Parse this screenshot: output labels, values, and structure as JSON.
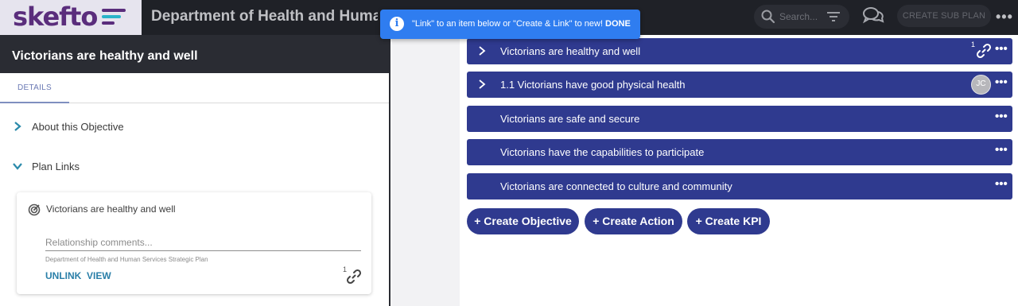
{
  "app": {
    "logo_text": "skefto",
    "brand_colors": {
      "logo": "#5a2d7c",
      "accent": "#2f3a8f",
      "toast": "#2f7df0",
      "link": "#2a7fa8"
    },
    "title": "Department of Health and Human Services Strategic Plan"
  },
  "topbar": {
    "search_placeholder": "Search...",
    "search_icon": "search-icon",
    "filter_icon": "filter-icon",
    "chat_icon": "chat-icon",
    "create_sub_plan_label": "CREATE SUB PLAN",
    "more_icon": "more-icon",
    "more_glyph": "•••"
  },
  "toast": {
    "icon": "info-icon",
    "icon_glyph": "i",
    "message": "\"Link\" to an item below or \"Create & Link\" to new!",
    "done_label": "DONE"
  },
  "left_panel": {
    "title": "Victorians are healthy and well",
    "tabs": [
      {
        "label": "DETAILS",
        "active": true
      }
    ],
    "sections": [
      {
        "label": "About this Objective",
        "expanded": false
      },
      {
        "label": "Plan Links",
        "expanded": true
      }
    ],
    "link_card": {
      "title": "Victorians are healthy and well",
      "icon": "objective-target-icon",
      "comment_placeholder": "Relationship comments...",
      "comment_value": "",
      "plan_name": "Department of Health and Human Services Strategic Plan",
      "unlink_label": "UNLINK",
      "view_label": "VIEW",
      "link_count": "1"
    }
  },
  "list": {
    "items": [
      {
        "label": "Victorians are healthy and well",
        "expandable": true,
        "link_count": "1",
        "has_link": true,
        "avatar": "",
        "more": "•••"
      },
      {
        "label": "1.1 Victorians have good physical health",
        "expandable": true,
        "link_count": "",
        "has_link": false,
        "avatar": "JC",
        "more": "•••"
      },
      {
        "label": "Victorians are safe and secure",
        "expandable": false,
        "link_count": "",
        "has_link": false,
        "avatar": "",
        "more": "•••"
      },
      {
        "label": "Victorians have the capabilities to participate",
        "expandable": false,
        "link_count": "",
        "has_link": false,
        "avatar": "",
        "more": "•••"
      },
      {
        "label": "Victorians are connected to culture and community",
        "expandable": false,
        "link_count": "",
        "has_link": false,
        "avatar": "",
        "more": "•••"
      }
    ],
    "buttons": [
      {
        "label": "+ Create Objective"
      },
      {
        "label": "+ Create Action"
      },
      {
        "label": "+ Create KPI"
      }
    ]
  }
}
